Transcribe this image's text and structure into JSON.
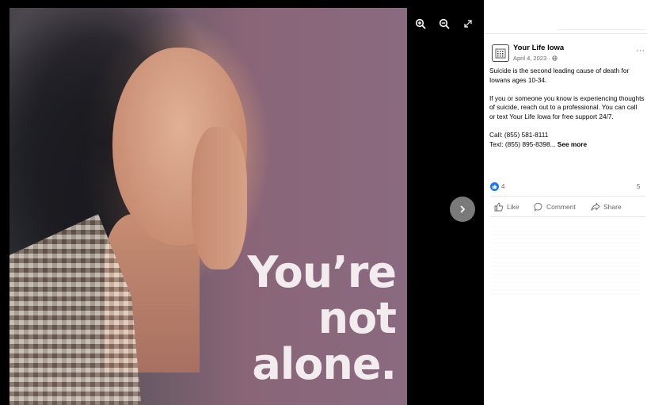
{
  "viewer": {
    "overlay_lines": [
      "You’re",
      "not",
      "alone."
    ],
    "toolbar": {
      "zoom_in": "zoom-in-icon",
      "zoom_out": "zoom-out-icon",
      "fullscreen": "fullscreen-icon"
    },
    "next_icon": "chevron-right-icon"
  },
  "post": {
    "page_name": "Your Life Iowa",
    "date": "April 4, 2023 · ",
    "more_label": "···",
    "paragraphs": [
      "Suicide is the second leading cause of death for Iowans ages 10-34.",
      "If you or someone you know is experiencing thoughts of suicide, reach out to a professional. You can call or text Your Life Iowa for free support 24/7."
    ],
    "call_line": "Call: (855) 581-8111",
    "text_line": "Text: (855) 895-8398...",
    "see_more": "See more",
    "reaction_count": "4",
    "comment_count": "5",
    "actions": {
      "like": "Like",
      "comment": "Comment",
      "share": "Share"
    }
  },
  "colors": {
    "accent": "#1877f2",
    "photo_purple": "#8a6a80",
    "overlay_text": "#f2ecef"
  }
}
